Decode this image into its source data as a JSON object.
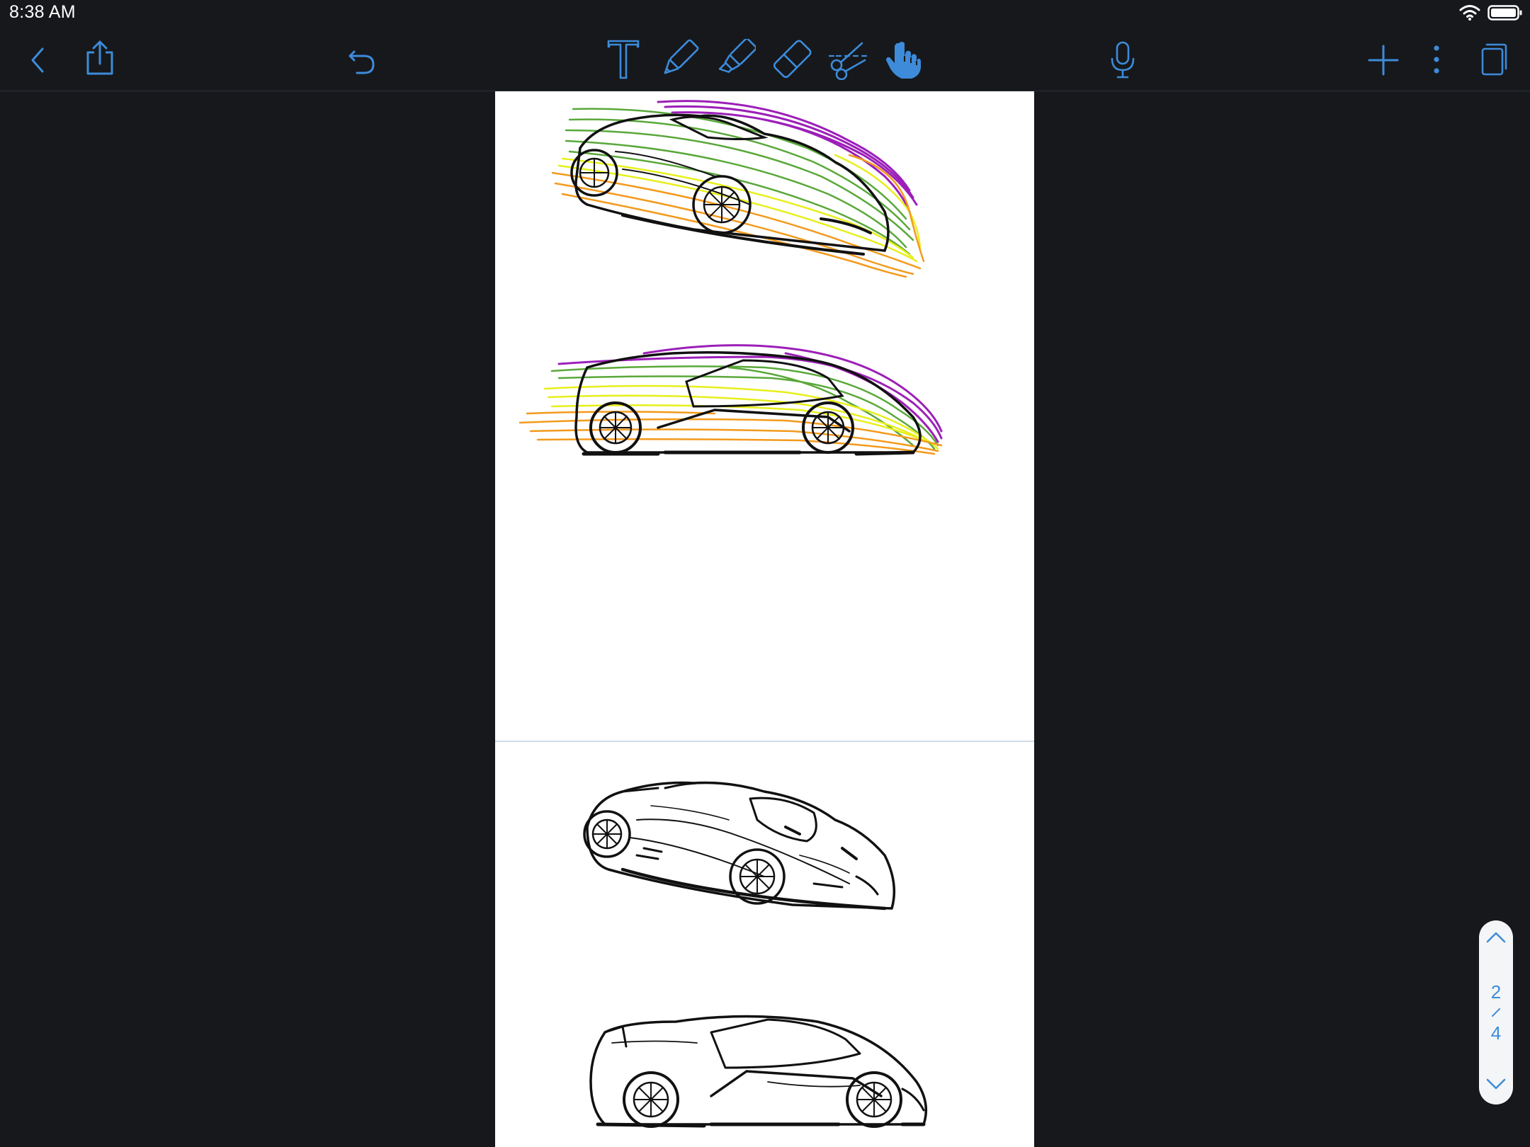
{
  "status": {
    "time": "8:38 AM",
    "wifi_icon": "wifi-icon",
    "battery_icon": "battery-icon"
  },
  "toolbar": {
    "left": [
      "back-icon",
      "share-icon",
      "undo-icon"
    ],
    "tools": [
      "text-tool-icon",
      "pen-tool-icon",
      "highlighter-tool-icon",
      "eraser-tool-icon",
      "lasso-tool-icon",
      "hand-tool-icon"
    ],
    "active_tool": "hand-tool-icon",
    "right": [
      "microphone-icon",
      "add-page-icon",
      "more-icon",
      "pages-icon"
    ]
  },
  "colors": {
    "accent": "#3d8bd9",
    "background": "#16181c",
    "page": "#ffffff",
    "stroke_purple": "#9c1fb8",
    "stroke_green": "#5aa83a",
    "stroke_yellow": "#e7ef1a",
    "stroke_orange": "#f39a1c"
  },
  "pager": {
    "current": "2",
    "total": "4",
    "up_icon": "chevron-up-icon",
    "down_icon": "chevron-down-icon"
  }
}
